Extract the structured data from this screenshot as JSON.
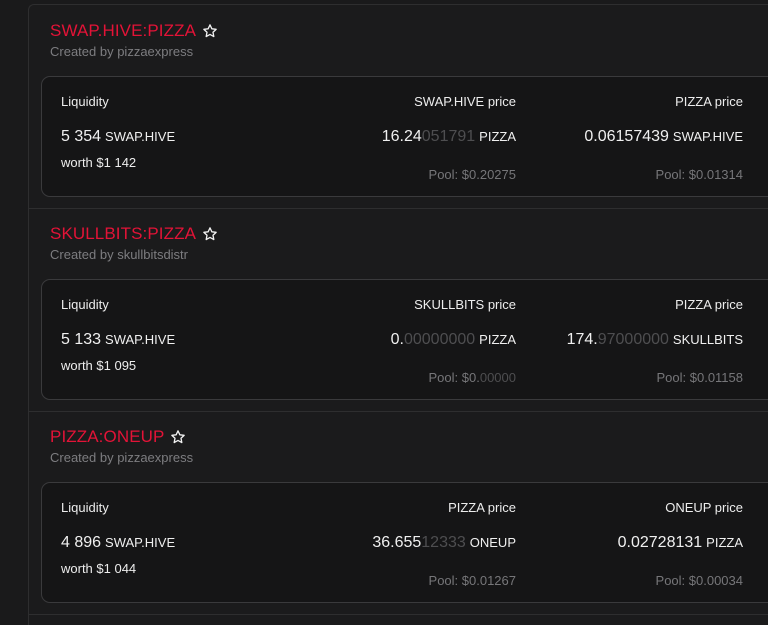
{
  "pools": [
    {
      "name": "SWAP.HIVE:PIZZA",
      "creator": "Created by pizzaexpress",
      "liquidity_label": "Liquidity",
      "liquidity_amount": "5 354",
      "liquidity_unit": "SWAP.HIVE",
      "worth": "worth $1 142",
      "price1_label": "SWAP.HIVE price",
      "price1_main": "16.24",
      "price1_dim": "051791",
      "price1_unit": "PIZZA",
      "pool1_main": "Pool: $0.20275",
      "pool1_dim": "",
      "price2_label": "PIZZA price",
      "price2_main": "0.06157439",
      "price2_dim": "",
      "price2_unit": "SWAP.HIVE",
      "pool2_main": "Pool: $0.01314",
      "pool2_dim": ""
    },
    {
      "name": "SKULLBITS:PIZZA",
      "creator": "Created by skullbitsdistr",
      "liquidity_label": "Liquidity",
      "liquidity_amount": "5 133",
      "liquidity_unit": "SWAP.HIVE",
      "worth": "worth $1 095",
      "price1_label": "SKULLBITS price",
      "price1_main": "0.",
      "price1_dim": "00000000",
      "price1_unit": "PIZZA",
      "pool1_main": "Pool: $0.",
      "pool1_dim": "00000",
      "price2_label": "PIZZA price",
      "price2_main": "174.",
      "price2_dim": "97000000",
      "price2_unit": "SKULLBITS",
      "pool2_main": "Pool: $0.01158",
      "pool2_dim": ""
    },
    {
      "name": "PIZZA:ONEUP",
      "creator": "Created by pizzaexpress",
      "liquidity_label": "Liquidity",
      "liquidity_amount": "4 896",
      "liquidity_unit": "SWAP.HIVE",
      "worth": "worth $1 044",
      "price1_label": "PIZZA price",
      "price1_main": "36.655",
      "price1_dim": "12333",
      "price1_unit": "ONEUP",
      "pool1_main": "Pool: $0.01267",
      "pool1_dim": "",
      "price2_label": "ONEUP price",
      "price2_main": "0.02728131",
      "price2_dim": "",
      "price2_unit": "PIZZA",
      "pool2_main": "Pool: $0.00034",
      "pool2_dim": ""
    }
  ],
  "icons": {
    "favorite": "star-outline-icon"
  },
  "colors": {
    "accent": "#e31337",
    "background": "#1a1a1b",
    "card": "#151516",
    "muted": "#7d7d80"
  }
}
